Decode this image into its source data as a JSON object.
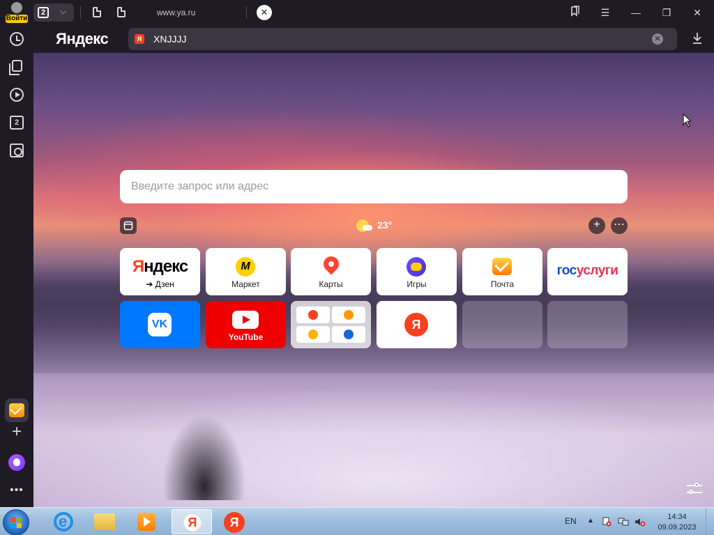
{
  "browser": {
    "profile_label": "Войти",
    "tab_count": "2",
    "tab_title": "www.ya.ru",
    "logo": "Яндекс",
    "address_value": "XNJJJJ",
    "ya_badge": "Я"
  },
  "sidebar": {
    "items": [
      "history-icon",
      "collections-icon",
      "video-icon",
      "tabs-icon",
      "screenshot-icon"
    ],
    "tabs_number": "2"
  },
  "newtab": {
    "search_placeholder": "Введите запрос или адрес",
    "weather_temp": "23°",
    "tiles_row1": [
      {
        "name": "Яндекс",
        "caption": "➔ Дзен"
      },
      {
        "name": "Маркет",
        "caption": "Маркет"
      },
      {
        "name": "Карты",
        "caption": "Карты"
      },
      {
        "name": "Игры",
        "caption": "Игры"
      },
      {
        "name": "Почта",
        "caption": "Почта"
      },
      {
        "name": "госуслуги",
        "caption": ""
      }
    ],
    "tiles_row2": [
      {
        "name": "VK",
        "caption": ""
      },
      {
        "name": "YouTube",
        "caption": "YouTube"
      },
      {
        "name": "group",
        "caption": ""
      },
      {
        "name": "Я",
        "caption": ""
      },
      {
        "name": "empty",
        "caption": ""
      },
      {
        "name": "empty",
        "caption": ""
      }
    ],
    "yandex_word_first": "Я",
    "yandex_word_rest": "ндекс",
    "gos_word_first": "гос",
    "gos_word_rest": "услуги",
    "vk_label": "VK",
    "market_label": "M",
    "ya_label": "Я"
  },
  "taskbar": {
    "language": "EN",
    "time": "14:34",
    "date": "09.09.2023"
  },
  "colors": {
    "yandex_red": "#fc3f1d",
    "vk_blue": "#0077ff",
    "youtube_red": "#ee0000",
    "chrome_dark": "#1f1b25"
  }
}
